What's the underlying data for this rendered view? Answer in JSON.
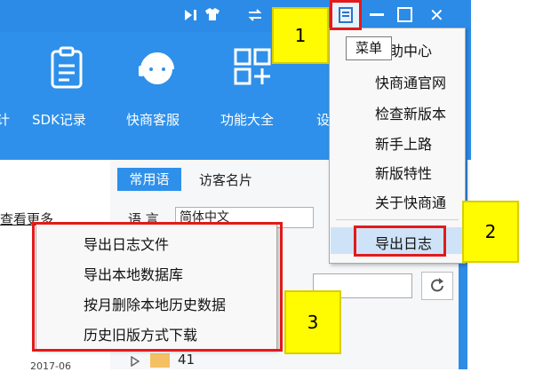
{
  "toolbar": {
    "cut_left": "计",
    "sdk": "SDK记录",
    "service": "快商客服",
    "features": "功能大全",
    "cut_right": "设"
  },
  "window_buttons": {
    "close": "✕"
  },
  "tabs": {
    "phrases": "常用语",
    "visitor_card": "访客名片"
  },
  "left": {
    "view_more": "查看更多",
    "year": "2017-06"
  },
  "right": {
    "language_label": "语 言",
    "language_value": "简体中文",
    "tree_item": "41"
  },
  "main_menu": {
    "tooltip": "菜单",
    "items": [
      "帮助中心",
      "快商通官网",
      "检查新版本",
      "新手上路",
      "新版特性",
      "关于快商通"
    ],
    "export_log": "导出日志"
  },
  "submenu": {
    "items": [
      "导出日志文件",
      "导出本地数据库",
      "按月删除本地历史数据",
      "历史旧版方式下载"
    ]
  },
  "callouts": [
    "1",
    "2",
    "3"
  ],
  "colors": {
    "accent": "#2e90ea",
    "callout": "#fffb00",
    "highlight": "#e21a1a"
  }
}
